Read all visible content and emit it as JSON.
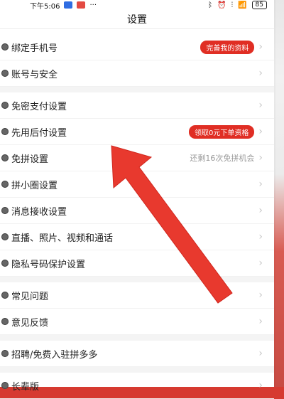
{
  "status": {
    "time": "下午5:06",
    "dots": "···",
    "battery": "85"
  },
  "page": {
    "title": "设置"
  },
  "groups": [
    {
      "items": [
        {
          "label": "绑定手机号",
          "badge": "完善我的资料"
        },
        {
          "label": "账号与安全"
        }
      ]
    },
    {
      "items": [
        {
          "label": "免密支付设置"
        },
        {
          "label": "先用后付设置",
          "badge": "领取0元下单资格"
        },
        {
          "label": "免拼设置",
          "hint": "还剩16次免拼机会"
        },
        {
          "label": "拼小圈设置"
        },
        {
          "label": "消息接收设置"
        },
        {
          "label": "直播、照片、视频和通话"
        },
        {
          "label": "隐私号码保护设置"
        }
      ]
    },
    {
      "items": [
        {
          "label": "常见问题"
        },
        {
          "label": "意见反馈"
        }
      ]
    },
    {
      "items": [
        {
          "label": "招聘/免费入驻拼多多"
        }
      ]
    },
    {
      "items": [
        {
          "label": "长辈版"
        }
      ]
    }
  ],
  "colors": {
    "accent_red": "#e02e24",
    "arrow_red": "#e8392e"
  },
  "icons": {
    "chevron": "chevron-right-icon",
    "bullet": "row-bullet-icon"
  }
}
